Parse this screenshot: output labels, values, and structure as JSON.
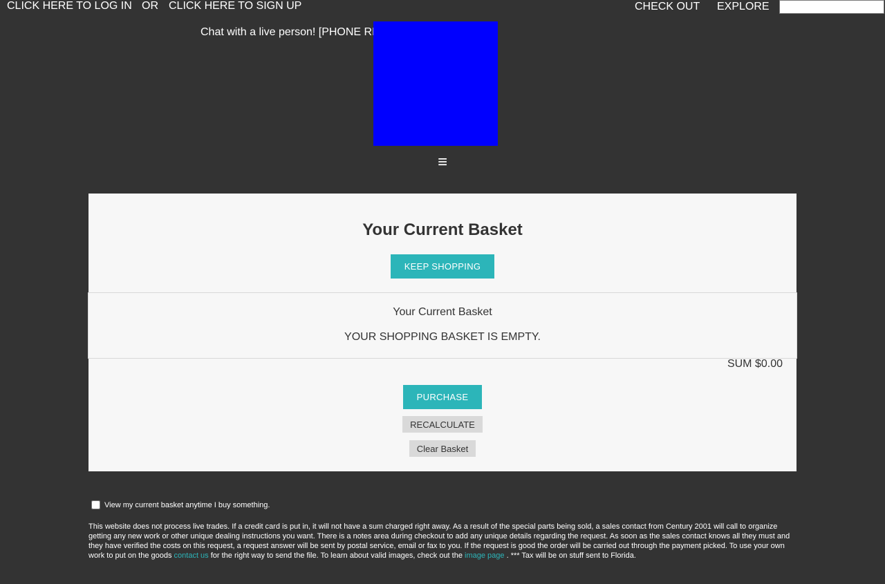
{
  "header": {
    "login_link": "CLICK HERE TO LOG IN",
    "or_text": "OR",
    "signup_link": "CLICK HERE TO SIGN UP",
    "checkout_link": "CHECK OUT",
    "explore_link": "EXPLORE",
    "search_value": ""
  },
  "chat_text": "Chat with a live person! [PHONE REDACTED]",
  "logo": {
    "color": "#0000ff"
  },
  "menu_icon": "≡",
  "basket": {
    "title": "Your Current Basket",
    "keep_shopping_label": "KEEP SHOPPING",
    "caption": "Your Current Basket",
    "empty_message": "YOUR SHOPPING BASKET IS EMPTY.",
    "sum_text": "SUM $0.00",
    "purchase_label": "PURCHASE",
    "recalculate_label": "RECALCULATE",
    "clear_label": "Clear Basket"
  },
  "footer": {
    "checkbox_label": "View my current basket anytime I buy something.",
    "checkbox_checked": false,
    "disclaimer_part1": "This website does not process live trades. If a credit card is put in, it will not have a sum charged right away. As a result of the special parts being sold, a sales contact from Century 2001 will call to organize getting any new work or other unique dealing instructions you want. There is a notes area during checkout to add any unique details regarding the request. As soon as the sales contact knows all they must and they have verified the costs on this request, a request answer will be sent by postal service, email or fax to you. If the request is good the order will be carried out through the payment picked. To use your own work to put on the goods",
    "contact_link": "contact us",
    "disclaimer_part2": "for the right way to send the file. To learn about valid images, check out the",
    "image_page_link": "image page",
    "disclaimer_part3": ". *** Tax will be on stuff sent to Florida."
  },
  "colors": {
    "background": "#333333",
    "panel": "#f7f7f7",
    "accent": "#2cb5b9",
    "secondary_button": "#d9d9d9"
  }
}
